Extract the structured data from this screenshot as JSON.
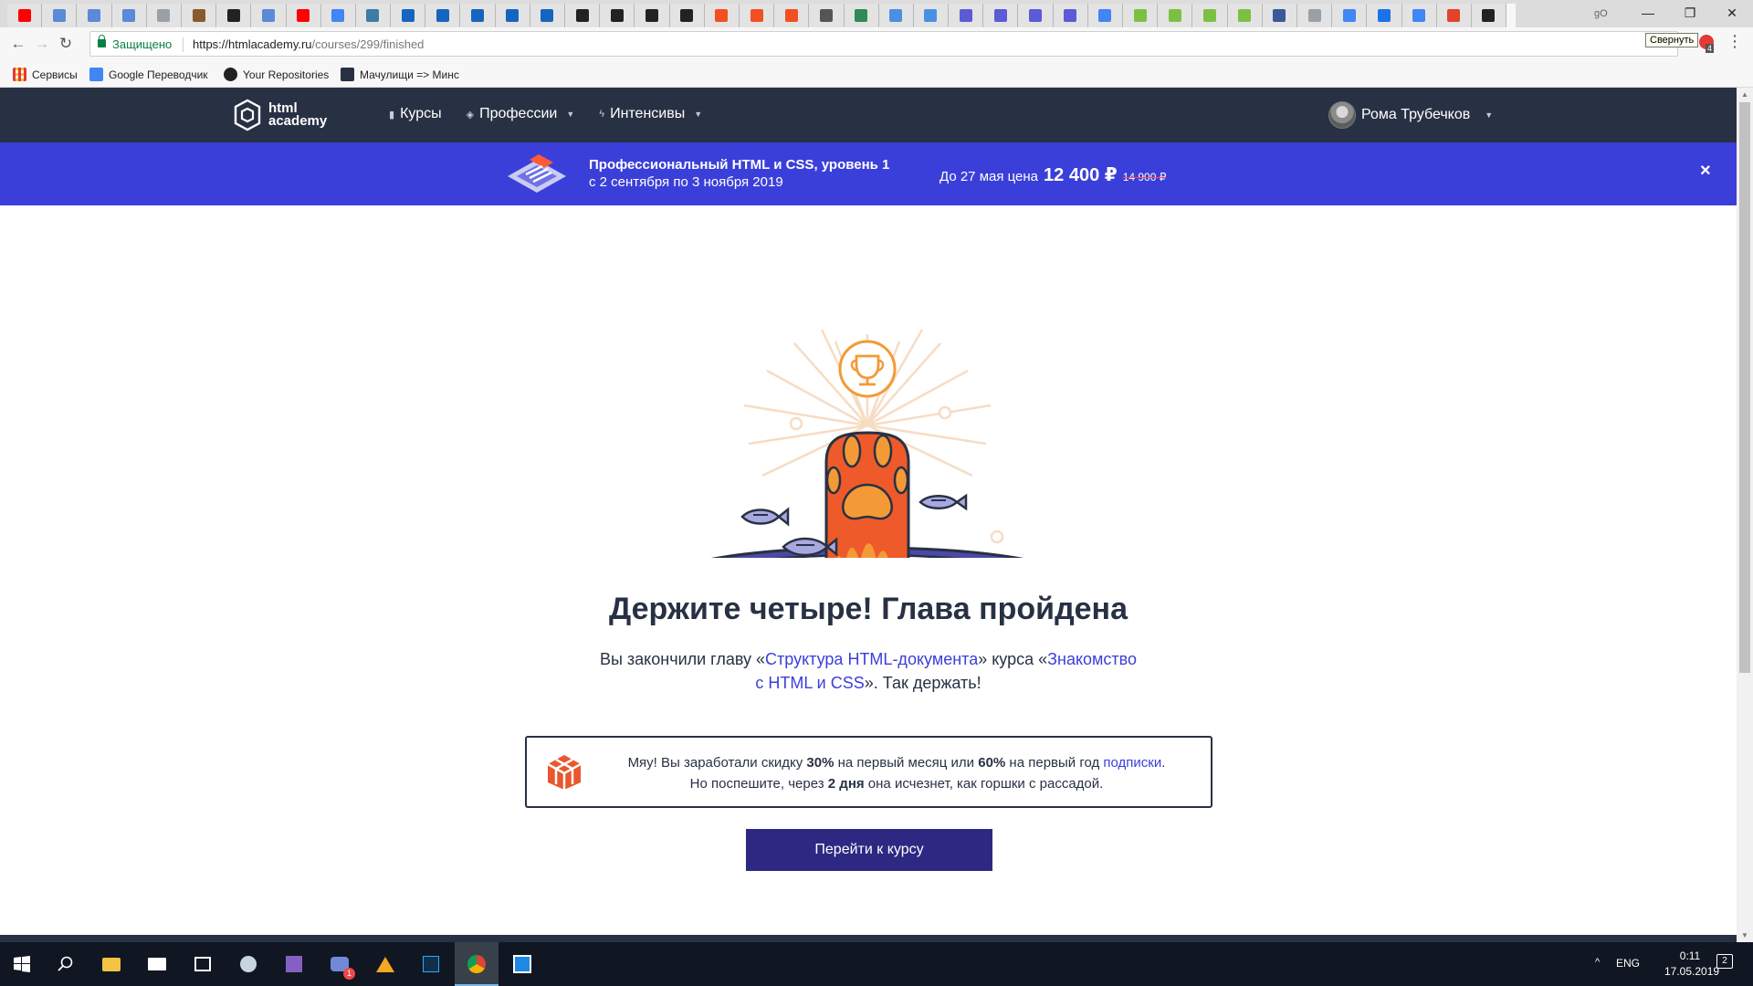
{
  "browser": {
    "window_user": "gO",
    "tab_favicons": [
      "#ff0000",
      "#5a8ad8",
      "#5a8ad8",
      "#5a8ad8",
      "#9aa0a6",
      "#8b5a2b",
      "#222222",
      "#5a8ad8",
      "#ff0000",
      "#4285f4",
      "#3d7ba8",
      "#1565c0",
      "#1565c0",
      "#1565c0",
      "#1565c0",
      "#1565c0",
      "#222222",
      "#222222",
      "#222222",
      "#222222",
      "#f25022",
      "#f25022",
      "#f25022",
      "#555555",
      "#2e8b57",
      "#4a90e2",
      "#4a90e2",
      "#5b5bd6",
      "#5b5bd6",
      "#5b5bd6",
      "#5b5bd6",
      "#4285f4",
      "#7bc043",
      "#7bc043",
      "#7bc043",
      "#7bc043",
      "#3b5998",
      "#9aa0a6",
      "#4285f4",
      "#1a73e8",
      "#4285f4",
      "#e24329",
      "#222222"
    ],
    "active_tab_close": "×",
    "secure_label": "Защищено",
    "url_host": "https://htmlacademy.ru",
    "url_path": "/courses/299/finished",
    "tooltip": "Свернуть",
    "badge": "4",
    "bookmarks": [
      "Сервисы",
      "Google Переводчик",
      "Your Repositories",
      "Мачулищи => Минс"
    ]
  },
  "site": {
    "logo_line1": "html",
    "logo_line2": "academy",
    "nav": [
      {
        "label": "Курсы",
        "icon": "bars-icon"
      },
      {
        "label": "Профессии",
        "icon": "hat-icon"
      },
      {
        "label": "Интенсивы",
        "icon": "lightning-icon"
      }
    ],
    "user_name": "Рома Трубечков"
  },
  "promo": {
    "title": "Профессиональный HTML и CSS, уровень 1",
    "dates": "с 2 сентября по 3 ноября 2019",
    "price_prefix": "До 27 мая цена",
    "price_now": "12 400 ₽",
    "price_old": "14 900 ₽",
    "close": "×"
  },
  "content": {
    "headline": "Держите четыре! Глава пройдена",
    "desc_part1": "Вы закончили главу «",
    "chapter_link": "Структура HTML-документа",
    "desc_part2": "» курса «",
    "course_link_1": "Знакомство",
    "course_link_2": "с HTML и CSS",
    "desc_part3": "». Так держать!",
    "bonus_part1": "Мяу! Вы заработали скидку ",
    "bonus_pct1": "30%",
    "bonus_part2": " на первый месяц или ",
    "bonus_pct2": "60%",
    "bonus_part3": " на первый год ",
    "bonus_link": "подписки",
    "bonus_part4": ".",
    "bonus_line2_a": "Но поспешите, через ",
    "bonus_days": "2 дня",
    "bonus_line2_b": " она исчезнет, как горшки с рассадой.",
    "button": "Перейти к курсу"
  },
  "taskbar": {
    "lang": "ENG",
    "time": "0:11",
    "date": "17.05.2019",
    "notif_count": "2",
    "discord_badge": "1"
  },
  "colors": {
    "header_bg": "#283144",
    "promo_bg": "#3b3fd9",
    "accent": "#2d2982",
    "paw": "#ee5a2a",
    "link": "#3b3fd9"
  }
}
